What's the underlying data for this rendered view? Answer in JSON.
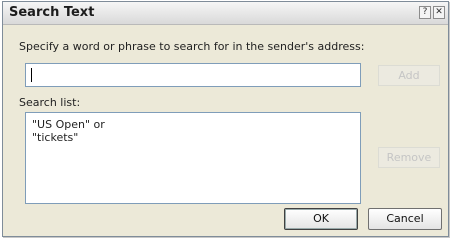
{
  "dialog": {
    "title": "Search Text",
    "help_glyph": "?",
    "close_glyph": "✕",
    "prompt": "Specify a word or phrase to search for in the sender's address:",
    "search_input": {
      "value": ""
    },
    "add_label": "Add",
    "search_list_label": "Search list:",
    "search_list": [
      "\"US Open\" or",
      "\"tickets\""
    ],
    "remove_label": "Remove",
    "ok_label": "OK",
    "cancel_label": "Cancel"
  }
}
